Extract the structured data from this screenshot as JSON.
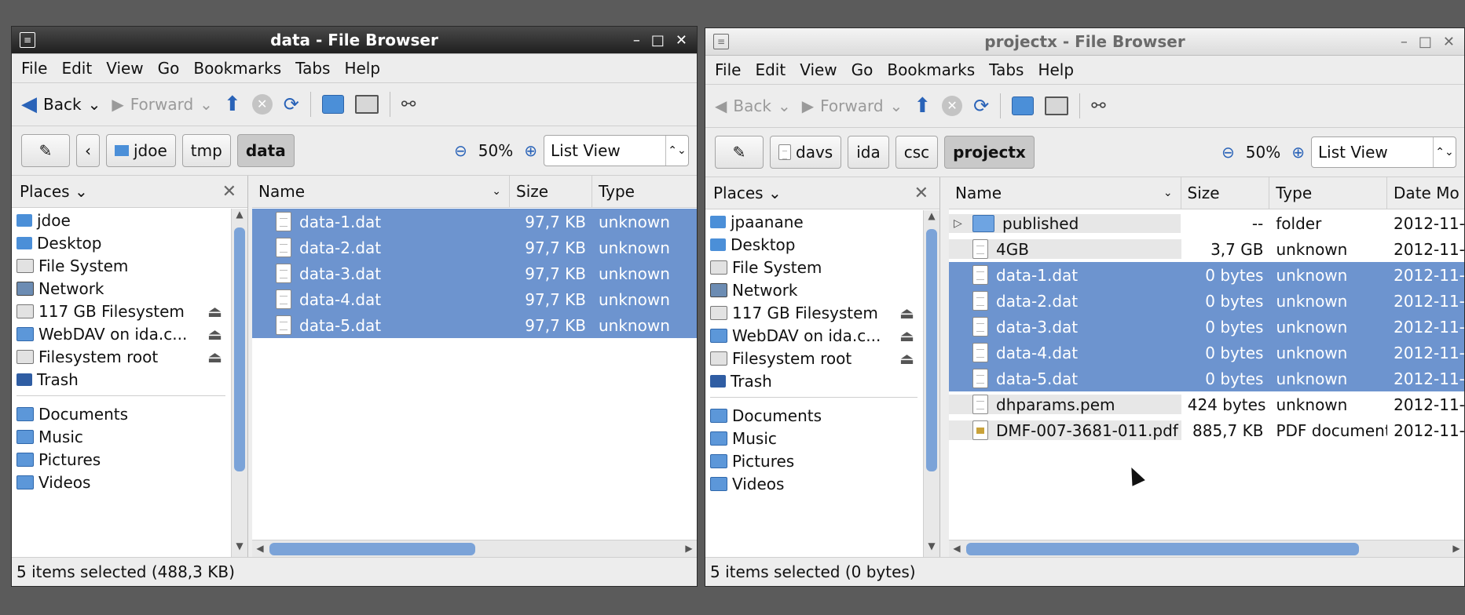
{
  "left_window": {
    "title": "data - File Browser",
    "menu": [
      "File",
      "Edit",
      "View",
      "Go",
      "Bookmarks",
      "Tabs",
      "Help"
    ],
    "toolbar": {
      "back": "Back",
      "forward": "Forward"
    },
    "path": [
      "jdoe",
      "tmp",
      "data"
    ],
    "zoom": "50%",
    "view": "List View",
    "places_label": "Places",
    "places": [
      "jdoe",
      "Desktop",
      "File System",
      "Network",
      "117 GB Filesystem",
      "WebDAV on ida.c...",
      "Filesystem root",
      "Trash"
    ],
    "bookmarks": [
      "Documents",
      "Music",
      "Pictures",
      "Videos"
    ],
    "columns": {
      "name": "Name",
      "size": "Size",
      "type": "Type"
    },
    "files": [
      {
        "name": "data-1.dat",
        "size": "97,7 KB",
        "type": "unknown"
      },
      {
        "name": "data-2.dat",
        "size": "97,7 KB",
        "type": "unknown"
      },
      {
        "name": "data-3.dat",
        "size": "97,7 KB",
        "type": "unknown"
      },
      {
        "name": "data-4.dat",
        "size": "97,7 KB",
        "type": "unknown"
      },
      {
        "name": "data-5.dat",
        "size": "97,7 KB",
        "type": "unknown"
      }
    ],
    "status": "5 items selected (488,3 KB)"
  },
  "right_window": {
    "title": "projectx - File Browser",
    "menu": [
      "File",
      "Edit",
      "View",
      "Go",
      "Bookmarks",
      "Tabs",
      "Help"
    ],
    "toolbar": {
      "back": "Back",
      "forward": "Forward"
    },
    "path": [
      "davs",
      "ida",
      "csc",
      "projectx"
    ],
    "zoom": "50%",
    "view": "List View",
    "places_label": "Places",
    "places": [
      "jpaanane",
      "Desktop",
      "File System",
      "Network",
      "117 GB Filesystem",
      "WebDAV on ida.c...",
      "Filesystem root",
      "Trash"
    ],
    "bookmarks": [
      "Documents",
      "Music",
      "Pictures",
      "Videos"
    ],
    "columns": {
      "name": "Name",
      "size": "Size",
      "type": "Type",
      "date": "Date Mo"
    },
    "files": [
      {
        "name": "published",
        "size": "--",
        "type": "folder",
        "date": "2012-11-"
      },
      {
        "name": "4GB",
        "size": "3,7 GB",
        "type": "unknown",
        "date": "2012-11-"
      },
      {
        "name": "data-1.dat",
        "size": "0 bytes",
        "type": "unknown",
        "date": "2012-11-"
      },
      {
        "name": "data-2.dat",
        "size": "0 bytes",
        "type": "unknown",
        "date": "2012-11-"
      },
      {
        "name": "data-3.dat",
        "size": "0 bytes",
        "type": "unknown",
        "date": "2012-11-"
      },
      {
        "name": "data-4.dat",
        "size": "0 bytes",
        "type": "unknown",
        "date": "2012-11-"
      },
      {
        "name": "data-5.dat",
        "size": "0 bytes",
        "type": "unknown",
        "date": "2012-11-"
      },
      {
        "name": "dhparams.pem",
        "size": "424 bytes",
        "type": "unknown",
        "date": "2012-11-"
      },
      {
        "name": "DMF-007-3681-011.pdf",
        "size": "885,7 KB",
        "type": "PDF document",
        "date": "2012-11-"
      }
    ],
    "status": "5 items selected (0 bytes)"
  },
  "colors": {
    "selection": "#6d94cf",
    "accent": "#2a63b8",
    "desktop": "#5b5b5b"
  }
}
